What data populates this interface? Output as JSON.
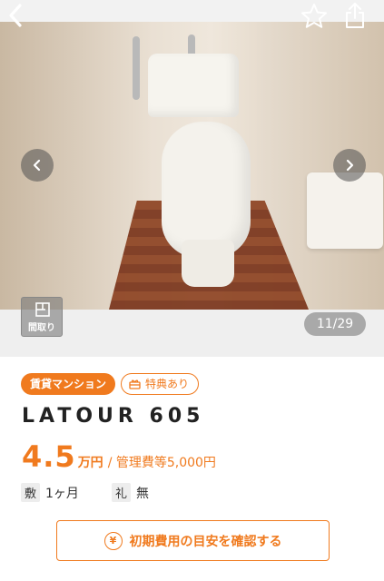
{
  "gallery": {
    "counter": "11/29",
    "floorplan_label": "間取り"
  },
  "tags": {
    "type": "賃貸マンション",
    "perk": "特典あり"
  },
  "property": {
    "name": "LATOUR 605"
  },
  "price": {
    "rent": "4.5",
    "rent_unit": "万円",
    "management": "/ 管理費等5,000円"
  },
  "fees": {
    "deposit_label": "敷",
    "deposit_value": "1ヶ月",
    "key_money_label": "礼",
    "key_money_value": "無"
  },
  "estimate_button": {
    "label": "初期費用の目安を確認する",
    "icon_glyph": "¥"
  },
  "colors": {
    "accent": "#f07a1e",
    "counter_bg": "#a9a9a9"
  },
  "icons": [
    "back-arrow-icon",
    "star-icon",
    "share-icon",
    "chevron-left-icon",
    "chevron-right-icon",
    "floorplan-icon",
    "gift-icon",
    "yen-icon"
  ]
}
